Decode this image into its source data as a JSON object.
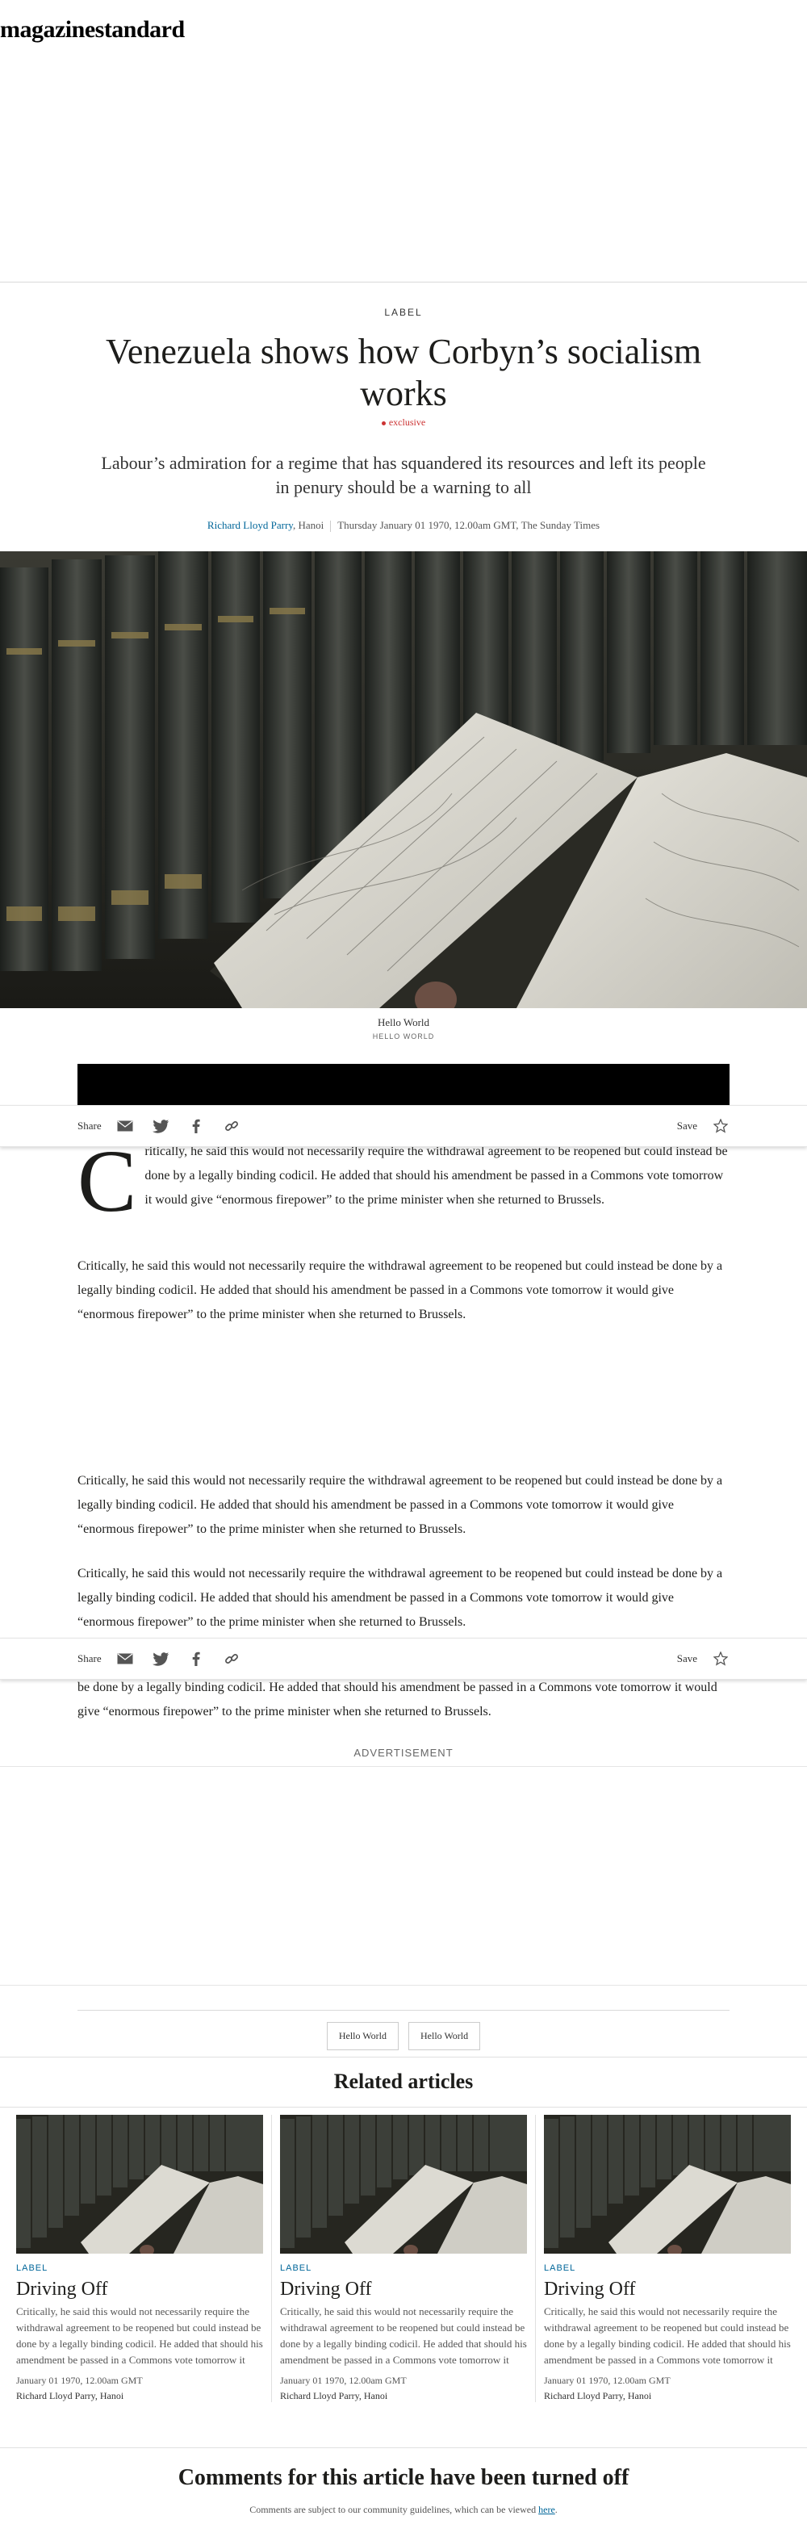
{
  "brand": {
    "logo": "magazinestandard"
  },
  "article": {
    "label": "LABEL",
    "headline": "Venezuela shows how Corbyn’s socialism works",
    "flag": "exclusive",
    "standfirst": "Labour’s admiration for a regime that has squandered its resources and left its people in penury should be a warning to all",
    "author": "Richard Lloyd Parry",
    "location": ", Hanoi",
    "dateline": "Thursday January 01 1970, 12.00am GMT, The Sunday Times",
    "caption": "Hello World",
    "caption_credit": "HELLO WORLD",
    "drop_cap": "C",
    "paragraph_1": "ritically, he said this would not necessarily require the withdrawal agreement to be reopened but could instead be done by a legally binding codicil. He added that should his amendment be passed in a Commons vote tomorrow it would give “enormous firepower” to the prime minister when she returned to Brussels.",
    "paragraph": "Critically, he said this would not necessarily require the withdrawal agreement to be reopened but could instead be done by a legally binding codicil. He added that should his amendment be passed in a Commons vote tomorrow it would give “enormous firepower” to the prime minister when she returned to Brussels.",
    "paragraph_tail": "be done by a legally binding codicil. He added that should his amendment be passed in a Commons vote tomorrow it would give “enormous firepower” to the prime minister when she returned to Brussels."
  },
  "share_bar": {
    "share_label": "Share",
    "save_label": "Save"
  },
  "advert": {
    "label": "ADVERTISEMENT"
  },
  "tags": [
    "Hello World",
    "Hello World"
  ],
  "related": {
    "heading": "Related articles",
    "cards": [
      {
        "label": "LABEL",
        "title": "Driving Off",
        "body": "Critically, he said this would not necessarily require the withdrawal agreement to be reopened but could instead be done by a legally binding codicil. He added that should his amendment be passed in a Commons vote tomorrow it would give “enormous firepower” to the prime minister when she returned to Brussels…",
        "date": "January 01 1970, 12.00am GMT",
        "author": "Richard Lloyd Parry, Hanoi"
      },
      {
        "label": "LABEL",
        "title": "Driving Off",
        "body": "Critically, he said this would not necessarily require the withdrawal agreement to be reopened but could instead be done by a legally binding codicil. He added that should his amendment be passed in a Commons vote tomorrow it would give “enormous firepower” to the prime minister when she returned to Brussels…",
        "date": "January 01 1970, 12.00am GMT",
        "author": "Richard Lloyd Parry, Hanoi"
      },
      {
        "label": "LABEL",
        "title": "Driving Off",
        "body": "Critically, he said this would not necessarily require the withdrawal agreement to be reopened but could instead be done by a legally binding codicil. He added that should his amendment be passed in a Commons vote tomorrow it would give “enormous firepower” to the prime minister when she returned to Brussels…",
        "date": "January 01 1970, 12.00am GMT",
        "author": "Richard Lloyd Parry, Hanoi"
      }
    ]
  },
  "comments": {
    "title": "Comments for this article have been turned off",
    "note": "Comments are subject to our community guidelines, which can be viewed ",
    "link": "here",
    "note_end": "."
  },
  "colors": {
    "link": "#006699",
    "exclusive": "#cc3333"
  },
  "icons": [
    "email-icon",
    "twitter-icon",
    "facebook-icon",
    "link-icon",
    "star-icon"
  ]
}
